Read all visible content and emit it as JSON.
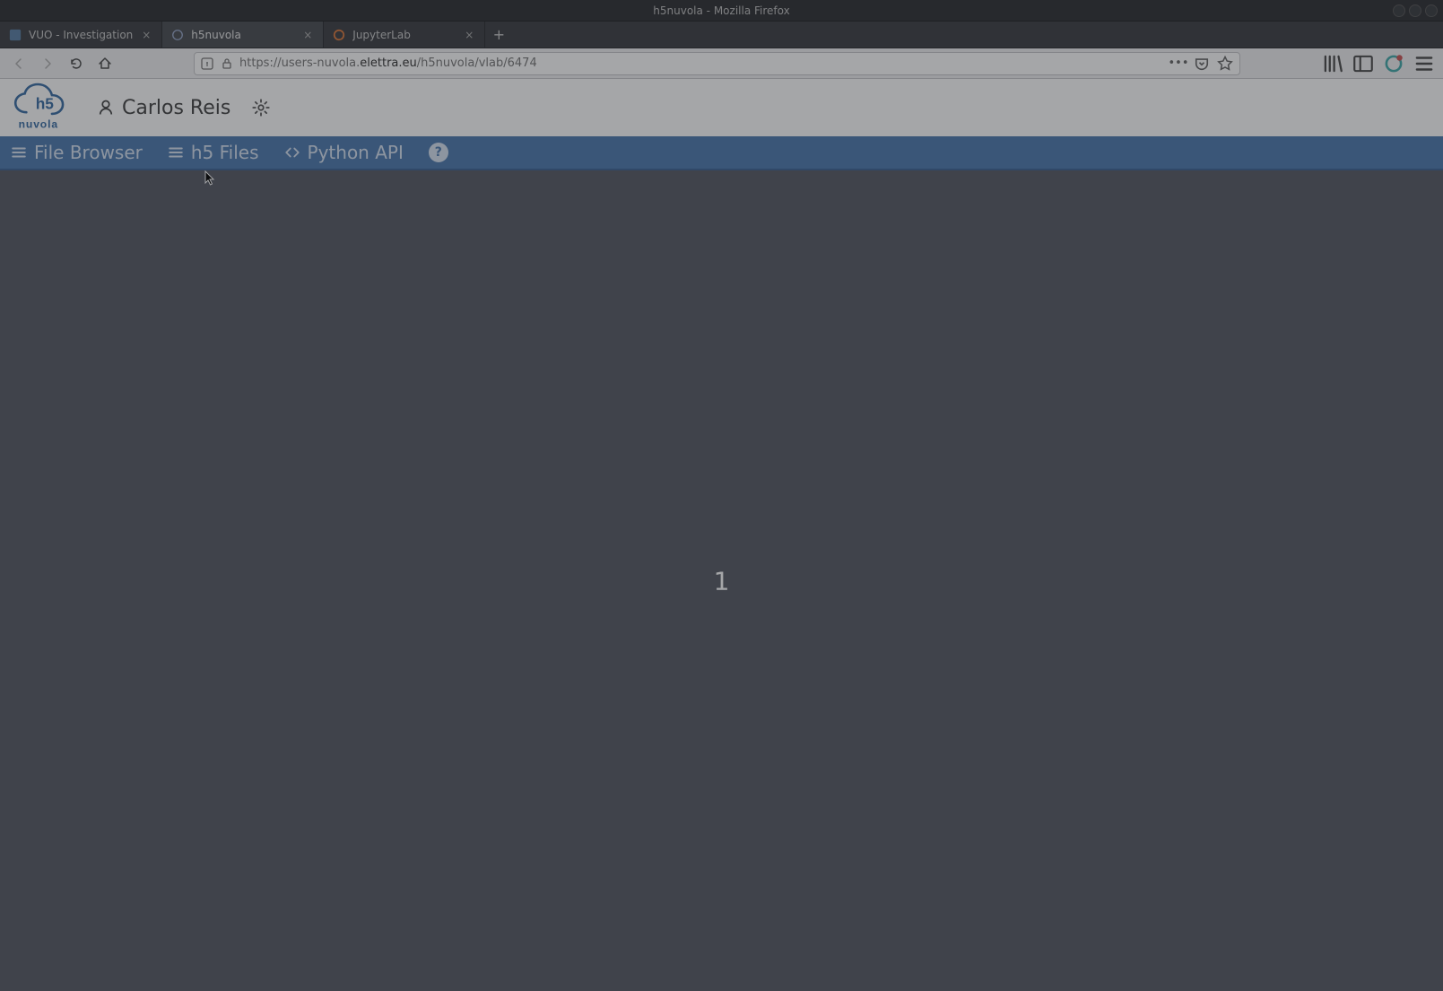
{
  "os": {
    "title": "h5nuvola - Mozilla Firefox"
  },
  "browser": {
    "tabs": [
      {
        "label": "VUO - Investigation",
        "active": false
      },
      {
        "label": "h5nuvola",
        "active": true
      },
      {
        "label": "JupyterLab",
        "active": false
      }
    ],
    "url": {
      "prefix": "https://users-nuvola.",
      "host": "elettra.eu",
      "path": "/h5nuvola/vlab/6474"
    },
    "more_actions_label": "•••"
  },
  "app": {
    "logo": {
      "top_text": "h5",
      "bottom_text": "nuvola"
    },
    "user_name": "Carlos Reis",
    "nav": {
      "file_browser": "File Browser",
      "h5_files": "h5 Files",
      "python_api": "Python API",
      "help_symbol": "?"
    },
    "body_center_text": "1"
  }
}
